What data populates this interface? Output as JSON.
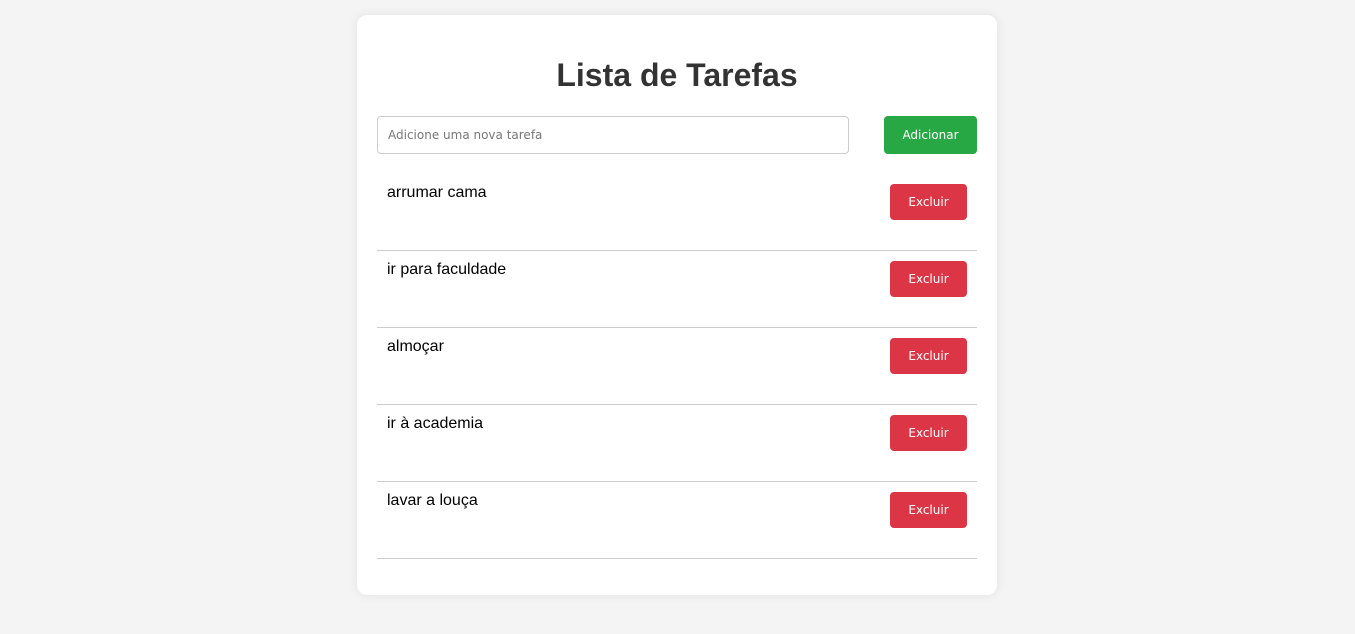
{
  "page": {
    "title": "Lista de Tarefas"
  },
  "form": {
    "input_value": "",
    "input_placeholder": "Adicione uma nova tarefa",
    "add_label": "Adicionar"
  },
  "tasks": [
    {
      "text": "arrumar cama",
      "delete_label": "Excluir"
    },
    {
      "text": "ir para faculdade",
      "delete_label": "Excluir"
    },
    {
      "text": "almoçar",
      "delete_label": "Excluir"
    },
    {
      "text": "ir à academia",
      "delete_label": "Excluir"
    },
    {
      "text": "lavar a louça",
      "delete_label": "Excluir"
    }
  ],
  "colors": {
    "background": "#f4f4f4",
    "card": "#ffffff",
    "title": "#333333",
    "add_button": "#28a745",
    "delete_button": "#dc3545",
    "divider": "#cccccc"
  }
}
